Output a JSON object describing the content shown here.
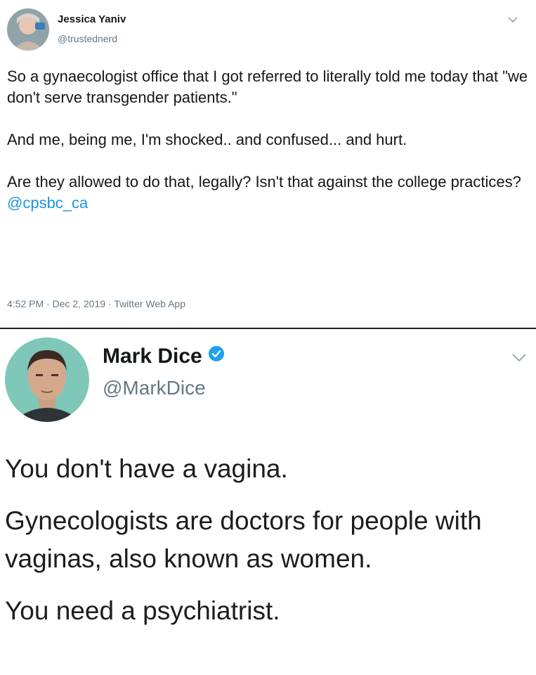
{
  "tweet1": {
    "avatar_icon": "avatar-jessica",
    "name": "Jessica Yaniv",
    "handle": "@trustednerd",
    "paragraphs": [
      "So a gynaecologist office that I got referred to literally told me today that \"we don't serve transgender patients.\"",
      "And me, being me, I'm shocked.. and confused... and hurt."
    ],
    "para3_text": "Are they allowed to do that, legally? Isn't that against the college practices? ",
    "para3_mention": "@cpsbc_ca",
    "time": "4:52 PM",
    "date": "Dec 2, 2019",
    "source": "Twitter Web App",
    "sep": "·"
  },
  "tweet2": {
    "avatar_icon": "avatar-mark",
    "name": "Mark Dice",
    "handle": "@MarkDice",
    "verified_icon": "verified-badge-icon",
    "paragraphs": [
      "You don't have a vagina.",
      "Gynecologists are doctors for people with vaginas, also known as women.",
      "You need a psychiatrist."
    ]
  },
  "colors": {
    "link": "#1b95e0",
    "secondary_text": "#657786",
    "verified": "#1da1f2"
  }
}
